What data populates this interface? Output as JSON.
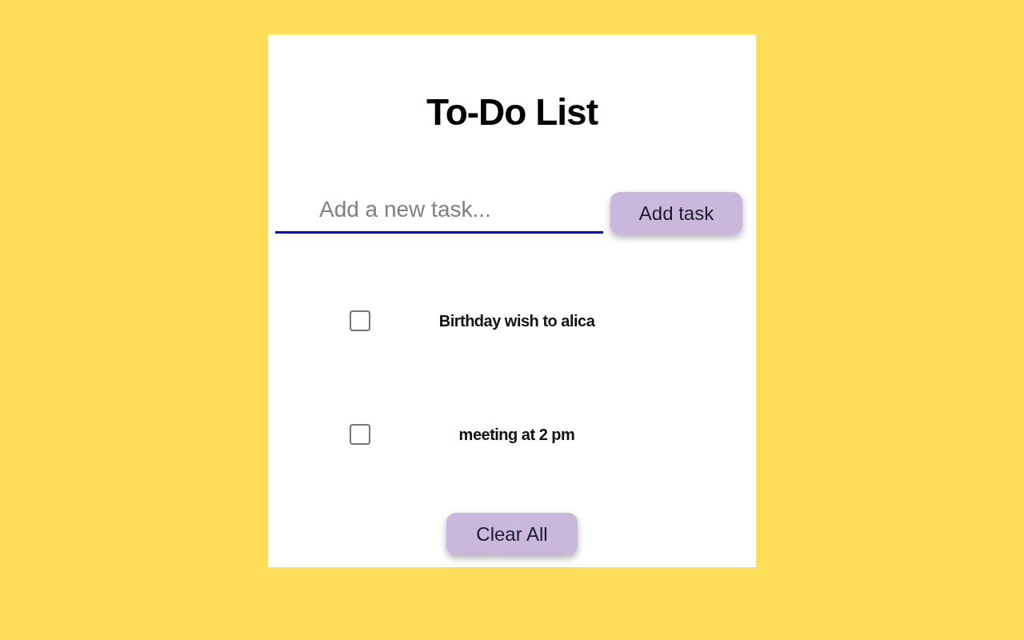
{
  "title": "To-Do List",
  "new_task": {
    "placeholder": "Add a new task..."
  },
  "add_button": "Add task",
  "tasks": [
    {
      "text": "Birthday wish to alica",
      "checked": false
    },
    {
      "text": "meeting at 2 pm",
      "checked": false
    }
  ],
  "clear_button": "Clear All"
}
